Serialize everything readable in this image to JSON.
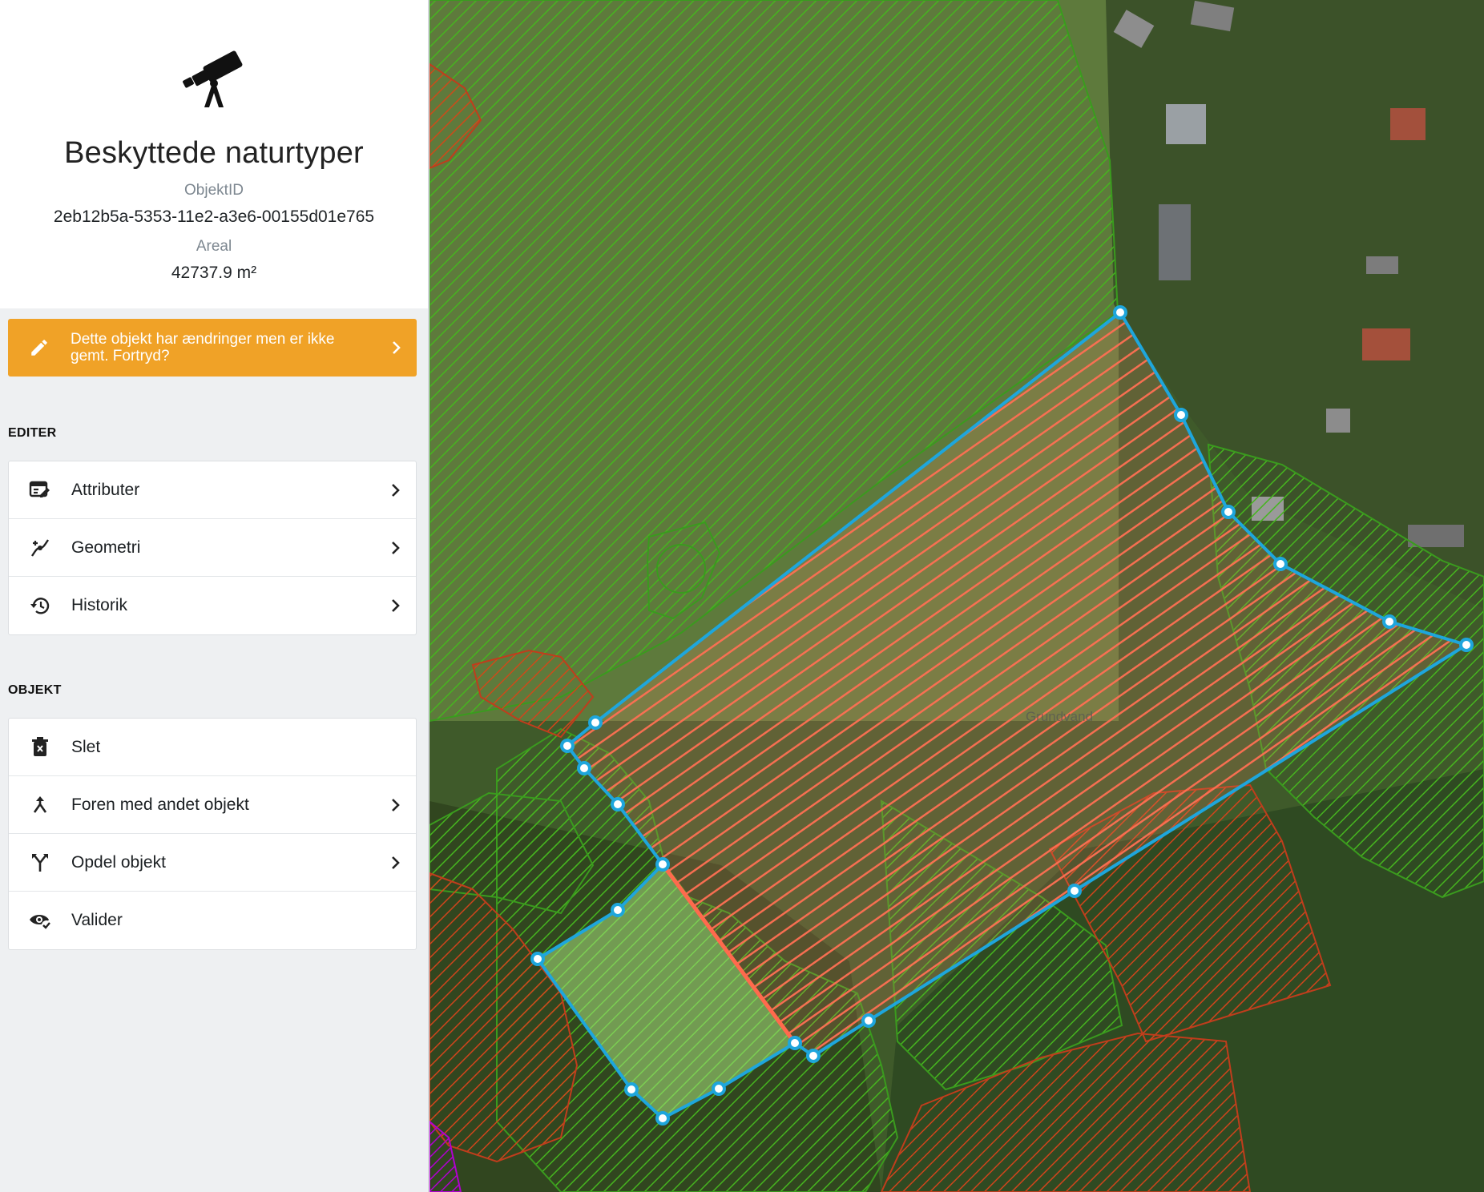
{
  "header": {
    "icon": "telescope-icon",
    "title": "Beskyttede naturtyper",
    "object_id_label": "ObjektID",
    "object_id_value": "2eb12b5a-5353-11e2-a3e6-00155d01e765",
    "area_label": "Areal",
    "area_value": "42737.9 m²"
  },
  "banner": {
    "icon": "pencil-icon",
    "text": "Dette objekt har ændringer men er ikke gemt. Fortryd?",
    "color": "#f0a227"
  },
  "edit_section": {
    "title": "EDITER",
    "items": [
      {
        "label": "Attributer",
        "icon": "attribute-edit-icon"
      },
      {
        "label": "Geometri",
        "icon": "geometry-draw-icon"
      },
      {
        "label": "Historik",
        "icon": "history-icon"
      }
    ]
  },
  "object_section": {
    "title": "OBJEKT",
    "items": [
      {
        "label": "Slet",
        "icon": "trash-icon"
      },
      {
        "label": "Foren med andet objekt",
        "icon": "merge-icon"
      },
      {
        "label": "Opdel objekt",
        "icon": "split-icon"
      },
      {
        "label": "Valider",
        "icon": "validate-eye-icon"
      }
    ]
  },
  "map": {
    "label_text": "Grundvand",
    "colors": {
      "protected_green": "#3a9b1e",
      "forest_red": "#c03d1c",
      "selected_fill": "#ff6a4d",
      "edit_outline": "#1ea6dc",
      "new_part_fill": "#a8e27c"
    }
  }
}
